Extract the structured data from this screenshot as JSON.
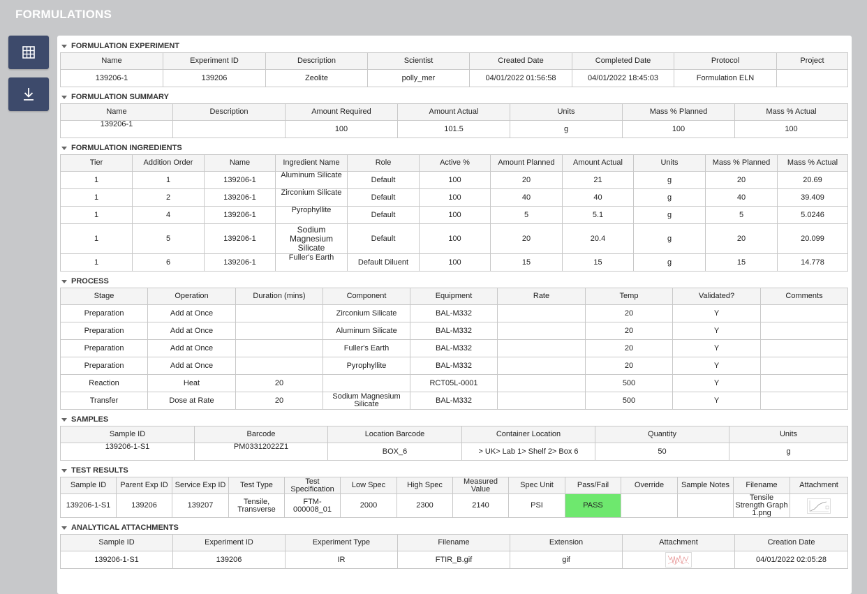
{
  "app": {
    "title": "FORMULATIONS"
  },
  "sidebar": {
    "grid_icon": "grid-icon",
    "download_icon": "download-icon"
  },
  "experiment": {
    "title": "FORMULATION EXPERIMENT",
    "headers": [
      "Name",
      "Experiment ID",
      "Description",
      "Scientist",
      "Created Date",
      "Completed Date",
      "Protocol",
      "Project"
    ],
    "row": [
      "139206-1",
      "139206",
      "Zeolite",
      "polly_mer",
      "04/01/2022 01:56:58",
      "04/01/2022 18:45:03",
      "Formulation ELN",
      ""
    ]
  },
  "summary": {
    "title": "FORMULATION SUMMARY",
    "headers": [
      "Name",
      "Description",
      "Amount Required",
      "Amount Actual",
      "Units",
      "Mass % Planned",
      "Mass % Actual"
    ],
    "row": [
      "139206-1",
      "",
      "100",
      "101.5",
      "g",
      "100",
      "100"
    ]
  },
  "ingredients": {
    "title": "FORMULATION INGREDIENTS",
    "headers": [
      "Tier",
      "Addition Order",
      "Name",
      "Ingredient Name",
      "Role",
      "Active %",
      "Amount Planned",
      "Amount Actual",
      "Units",
      "Mass % Planned",
      "Mass % Actual"
    ],
    "rows": [
      [
        "1",
        "1",
        "139206-1",
        "Aluminum Silicate",
        "Default",
        "100",
        "20",
        "21",
        "g",
        "20",
        "20.69"
      ],
      [
        "1",
        "2",
        "139206-1",
        "Zirconium Silicate",
        "Default",
        "100",
        "40",
        "40",
        "g",
        "40",
        "39.409"
      ],
      [
        "1",
        "4",
        "139206-1",
        "Pyrophyllite",
        "Default",
        "100",
        "5",
        "5.1",
        "g",
        "5",
        "5.0246"
      ],
      [
        "1",
        "5",
        "139206-1",
        "Sodium Magnesium Silicate",
        "Default",
        "100",
        "20",
        "20.4",
        "g",
        "20",
        "20.099"
      ],
      [
        "1",
        "6",
        "139206-1",
        "Fuller's Earth",
        "Default Diluent",
        "100",
        "15",
        "15",
        "g",
        "15",
        "14.778"
      ]
    ]
  },
  "process": {
    "title": "PROCESS",
    "headers": [
      "Stage",
      "Operation",
      "Duration (mins)",
      "Component",
      "Equipment",
      "Rate",
      "Temp",
      "Validated?",
      "Comments"
    ],
    "rows": [
      [
        "Preparation",
        "Add at Once",
        "",
        "Zirconium Silicate",
        "BAL-M332",
        "",
        "20",
        "Y",
        ""
      ],
      [
        "Preparation",
        "Add at Once",
        "",
        "Aluminum Silicate",
        "BAL-M332",
        "",
        "20",
        "Y",
        ""
      ],
      [
        "Preparation",
        "Add at Once",
        "",
        "Fuller's Earth",
        "BAL-M332",
        "",
        "20",
        "Y",
        ""
      ],
      [
        "Preparation",
        "Add at Once",
        "",
        "Pyrophyllite",
        "BAL-M332",
        "",
        "20",
        "Y",
        ""
      ],
      [
        "Reaction",
        "Heat",
        "20",
        "",
        "RCT05L-0001",
        "",
        "500",
        "Y",
        ""
      ],
      [
        "Transfer",
        "Dose at Rate",
        "20",
        "Sodium Magnesium Silicate",
        "BAL-M332",
        "",
        "500",
        "Y",
        ""
      ]
    ]
  },
  "samples": {
    "title": "SAMPLES",
    "headers": [
      "Sample ID",
      "Barcode",
      "Location Barcode",
      "Container Location",
      "Quantity",
      "Units"
    ],
    "row": [
      "139206-1-S1",
      "PM03312022Z1",
      "BOX_6",
      "> UK> Lab 1> Shelf 2> Box 6",
      "50",
      "g"
    ]
  },
  "test_results": {
    "title": "TEST RESULTS",
    "headers": [
      "Sample ID",
      "Parent Exp ID",
      "Service Exp ID",
      "Test Type",
      "Test Specification",
      "Low Spec",
      "High Spec",
      "Measured Value",
      "Spec Unit",
      "Pass/Fail",
      "Override",
      "Sample Notes",
      "Filename",
      "Attachment"
    ],
    "row": [
      "139206-1-S1",
      "139206",
      "139207",
      "Tensile, Transverse",
      "FTM-000008_01",
      "2000",
      "2300",
      "2140",
      "PSI",
      "PASS",
      "",
      "",
      "Tensile Strength Graph 1.png",
      ""
    ],
    "pass_color": "#6ee86e"
  },
  "attachments": {
    "title": "ANALYTICAL ATTACHMENTS",
    "headers": [
      "Sample ID",
      "Experiment ID",
      "Experiment Type",
      "Filename",
      "Extension",
      "Attachment",
      "Creation Date"
    ],
    "row": [
      "139206-1-S1",
      "139206",
      "IR",
      "FTIR_B.gif",
      "gif",
      "",
      "04/01/2022 02:05:28"
    ]
  },
  "colors": {
    "accent": "#3d4a6b",
    "link": "#1f5fbf",
    "background": "#c7c8ca"
  }
}
